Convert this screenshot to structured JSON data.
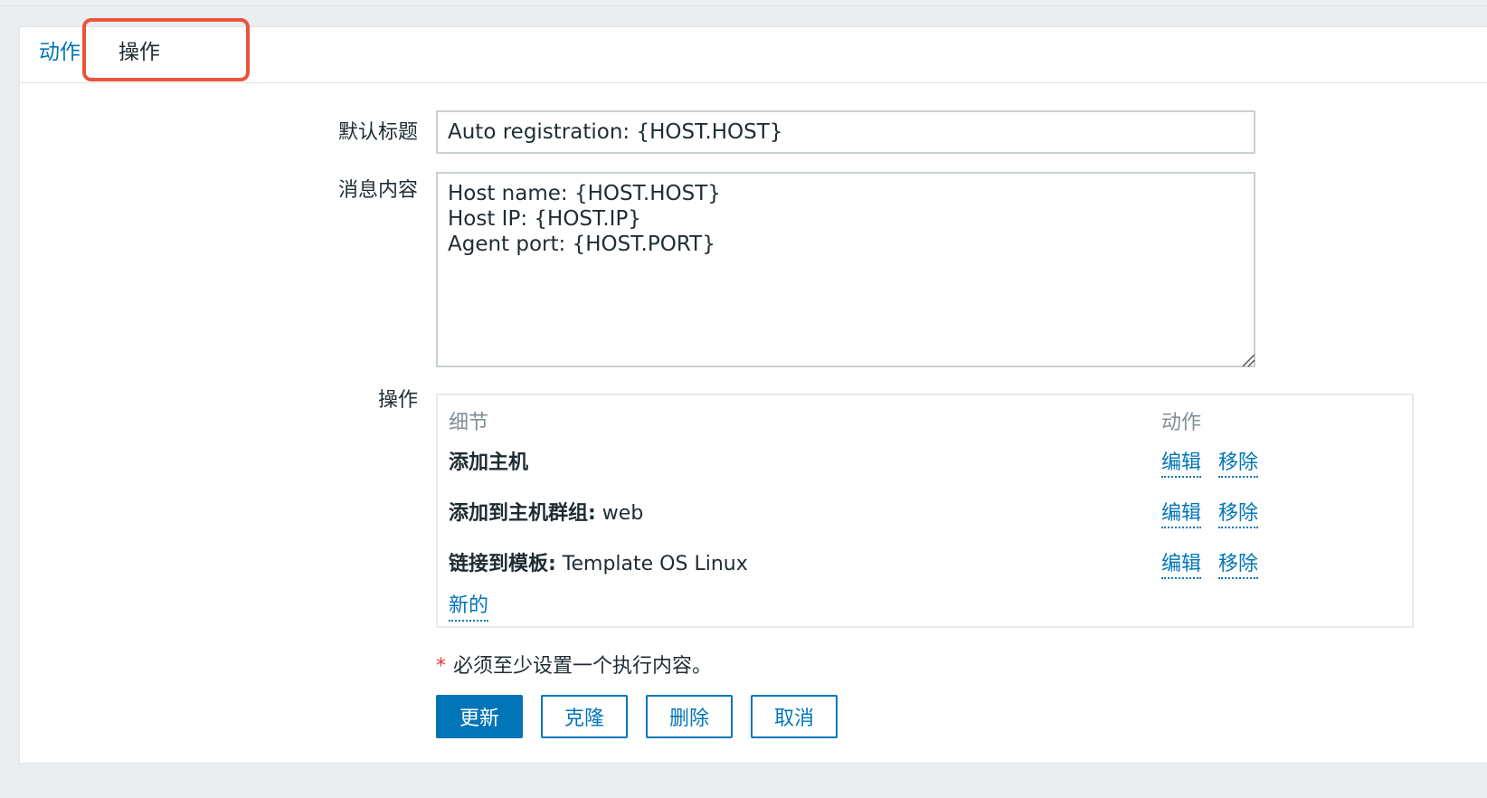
{
  "tabs": {
    "action_label": "动作",
    "operations_label": "操作"
  },
  "form": {
    "default_title_label": "默认标题",
    "default_title_value": "Auto registration: {HOST.HOST}",
    "message_label": "消息内容",
    "message_value": "Host name: {HOST.HOST}\nHost IP: {HOST.IP}\nAgent port: {HOST.PORT}",
    "operations_label": "操作"
  },
  "operations": {
    "header_details": "细节",
    "header_action": "动作",
    "rows": [
      {
        "bold": "添加主机",
        "rest": ""
      },
      {
        "bold": "添加到主机群组:",
        "rest": " web"
      },
      {
        "bold": "链接到模板:",
        "rest": " Template OS Linux"
      }
    ],
    "edit_label": "编辑",
    "remove_label": "移除",
    "new_label": "新的"
  },
  "required_note": "必须至少设置一个执行内容。",
  "required_mark": "*",
  "buttons": {
    "update": "更新",
    "clone": "克隆",
    "delete": "删除",
    "cancel": "取消"
  },
  "colors": {
    "accent": "#0275b8",
    "highlight": "#e8553b",
    "required": "#e33734"
  }
}
